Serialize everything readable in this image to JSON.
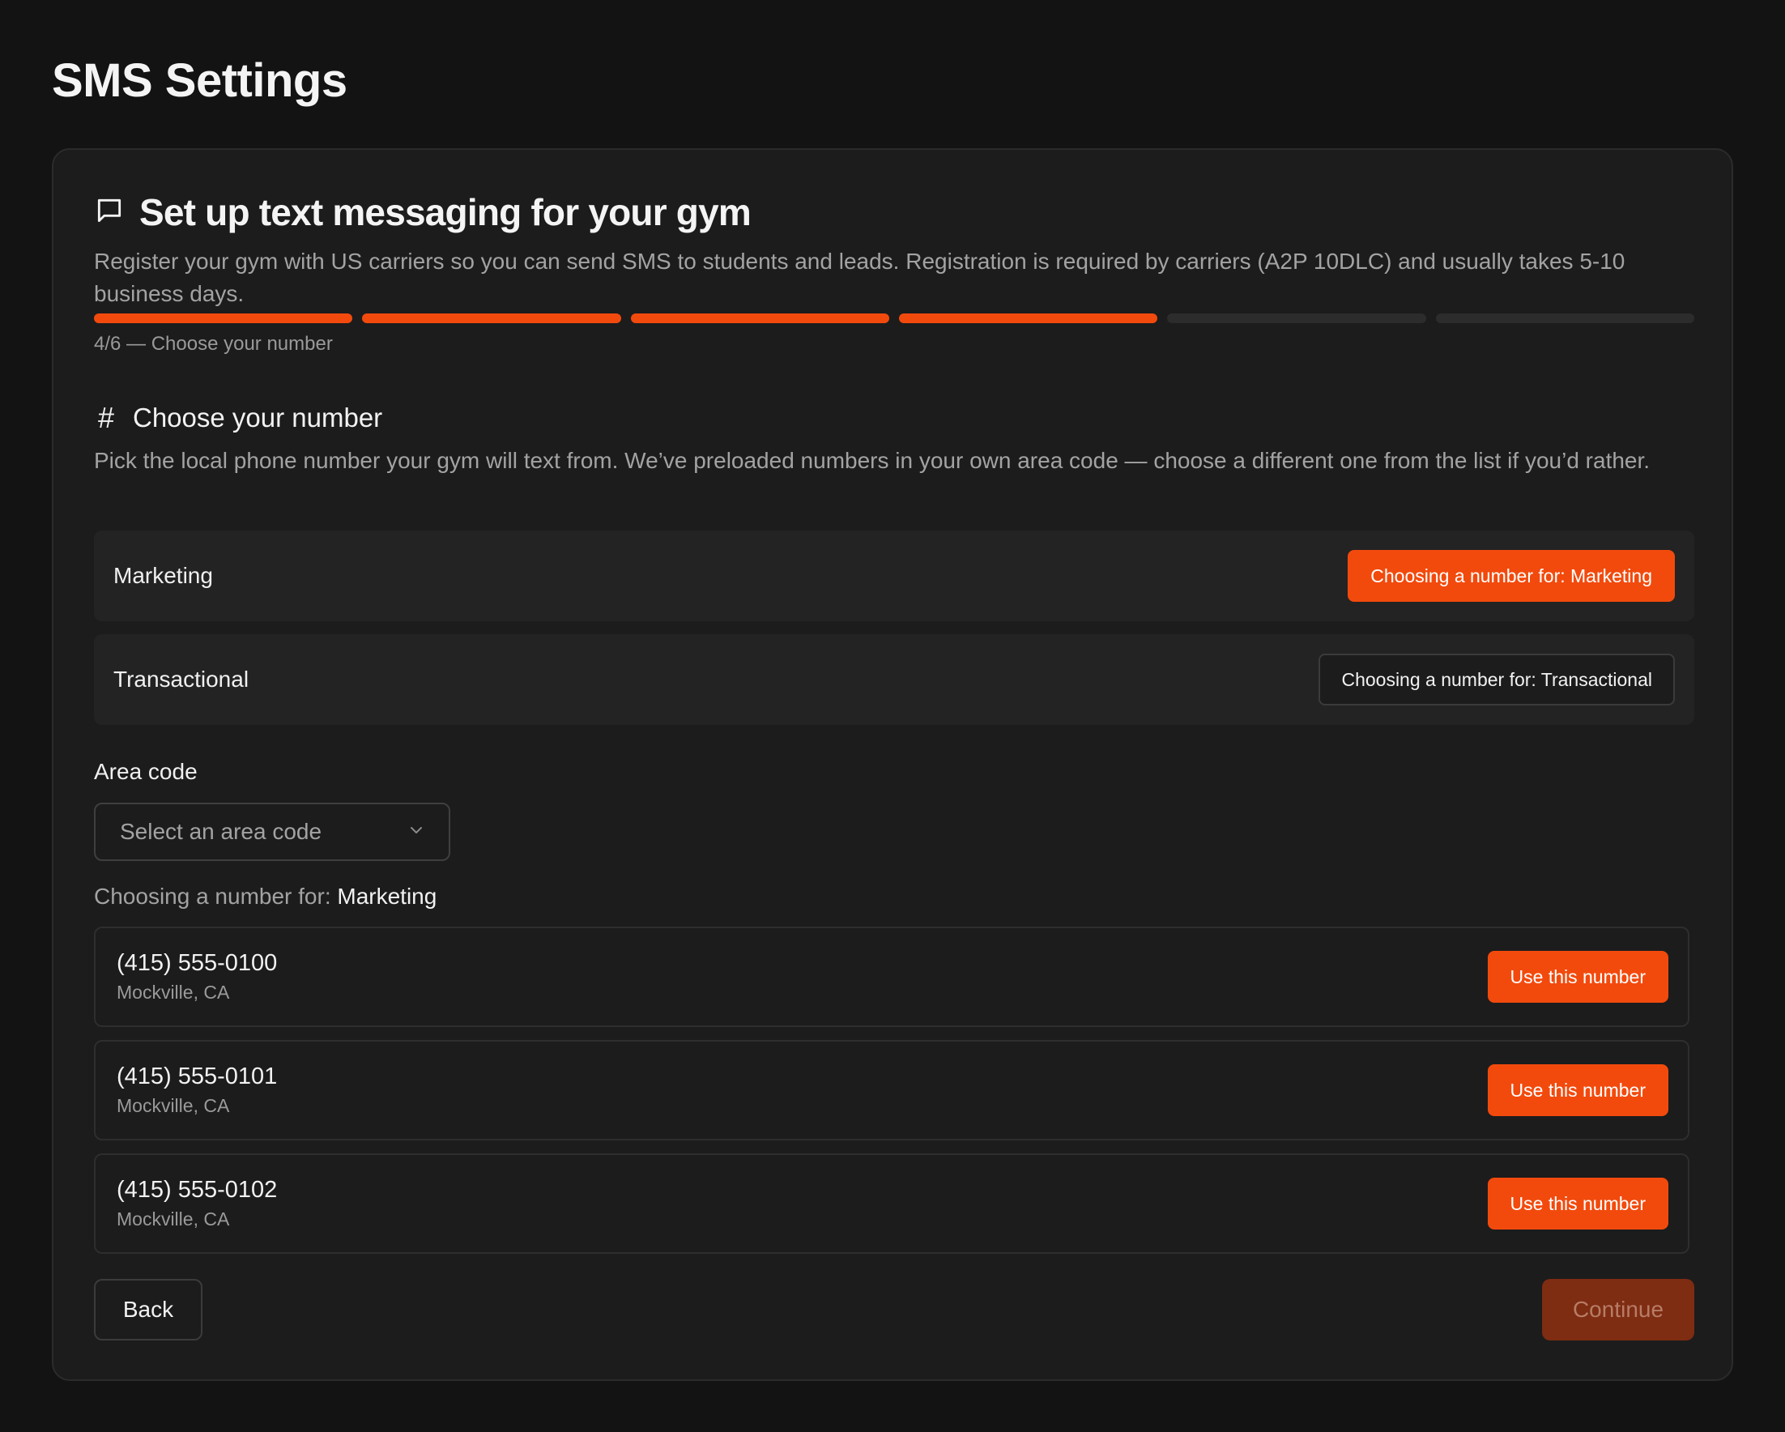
{
  "page": {
    "title": "SMS Settings"
  },
  "card": {
    "title": "Set up text messaging for your gym",
    "description": "Register your gym with US carriers so you can send SMS to students and leads. Registration is required by carriers (A2P 10DLC) and usually takes 5-10 business days.",
    "progress": {
      "current_step": 4,
      "total_steps": 6,
      "label": "4/6 — Choose your number"
    },
    "icon": "message-square-icon"
  },
  "section": {
    "icon": "hash-icon",
    "title": "Choose your number",
    "description": "Pick the local phone number your gym will text from. We’ve preloaded numbers in your own area code — choose a different one from the list if you’d rather."
  },
  "purposes": [
    {
      "label": "Marketing",
      "button_label": "Choosing a number for: Marketing",
      "active": true
    },
    {
      "label": "Transactional",
      "button_label": "Choosing a number for: Transactional",
      "active": false
    }
  ],
  "area_code": {
    "label": "Area code",
    "placeholder": "Select an area code"
  },
  "choosing": {
    "prefix": "Choosing a number for:",
    "value": "Marketing"
  },
  "numbers": [
    {
      "number": "(415) 555-0100",
      "location": "Mockville, CA",
      "button_label": "Use this number"
    },
    {
      "number": "(415) 555-0101",
      "location": "Mockville, CA",
      "button_label": "Use this number"
    },
    {
      "number": "(415) 555-0102",
      "location": "Mockville, CA",
      "button_label": "Use this number"
    }
  ],
  "footer": {
    "back_label": "Back",
    "continue_label": "Continue",
    "continue_disabled": true
  },
  "colors": {
    "accent": "#f24a0d",
    "background": "#131313",
    "card": "#1c1c1c",
    "continue_disabled_bg": "#7e2c12"
  }
}
